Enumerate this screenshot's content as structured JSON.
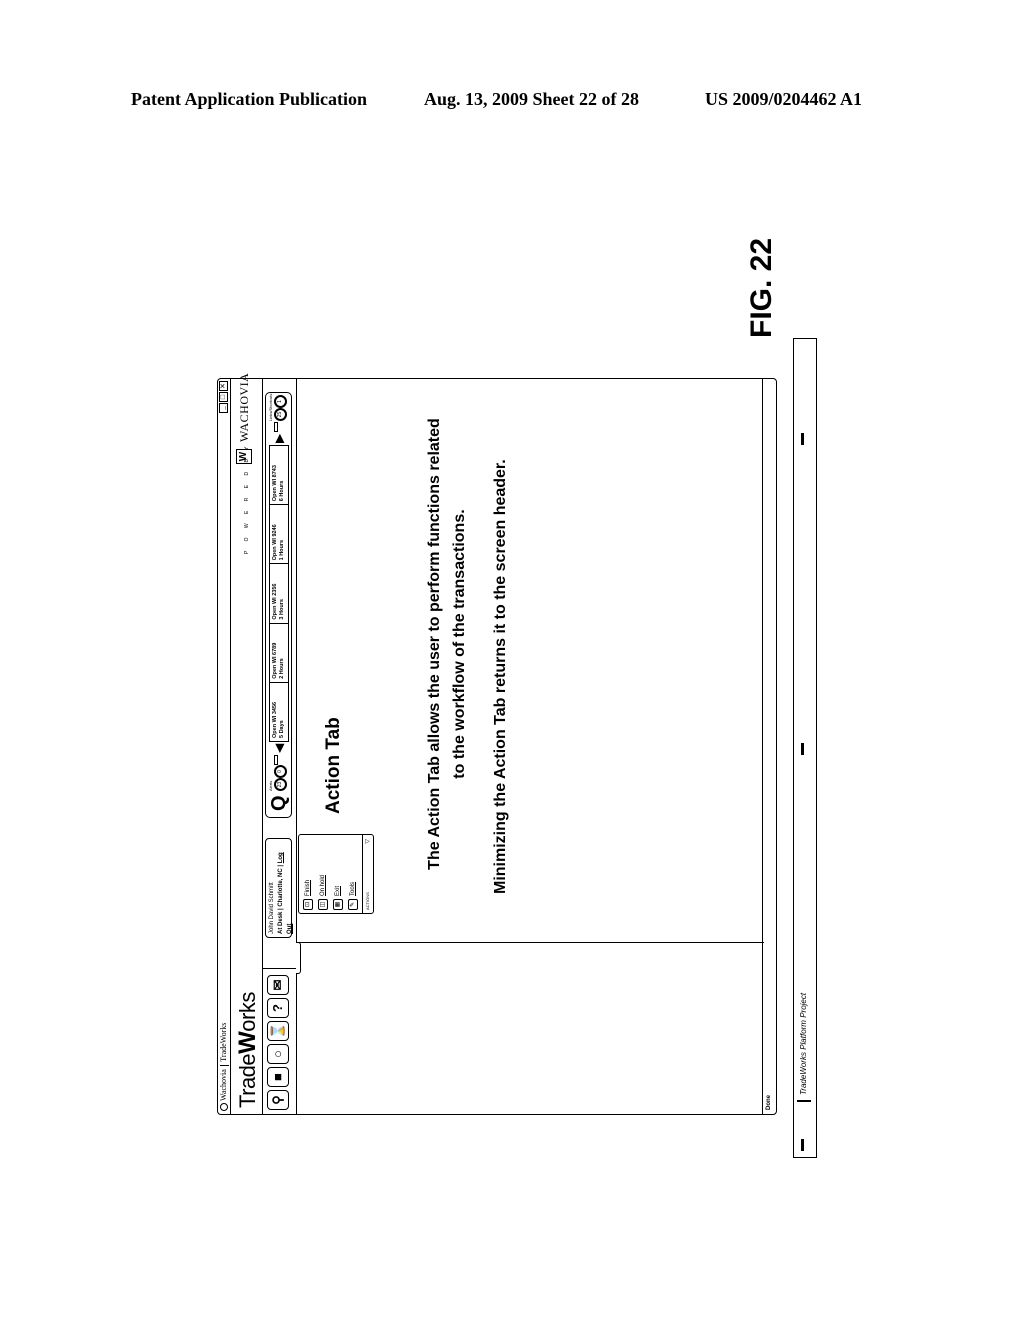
{
  "page_header": {
    "left": "Patent Application Publication",
    "middle": "Aug. 13, 2009  Sheet 22 of 28",
    "right": "US 2009/0204462 A1"
  },
  "window": {
    "titlebar": {
      "tab1": "Wachovia",
      "tab2": "TradeWorks",
      "controls": [
        "_",
        "□",
        "✕"
      ]
    },
    "brand": {
      "part1": "Trade",
      "part2": "W",
      "part3": "orks"
    },
    "powered_by": "P O W E R E D  B Y",
    "partner_logo_glyph": "W",
    "partner_name": "WACHOVIA",
    "toolbar": {
      "buttons": [
        {
          "name": "search",
          "glyph": "⚲"
        },
        {
          "name": "stop",
          "glyph": "■"
        },
        {
          "name": "circle",
          "glyph": "○"
        },
        {
          "name": "hourglass",
          "glyph": "⌛"
        },
        {
          "name": "help",
          "glyph": "?"
        },
        {
          "name": "mail",
          "glyph": "✉"
        }
      ],
      "user": {
        "name": "John David Schmitt",
        "status": "At Desk",
        "location": "Charlotte, NC",
        "logout": "Log Out"
      },
      "quick_search_glyph": "Q",
      "alerts": {
        "label": "Alerts",
        "values": [
          "23",
          "0"
        ]
      },
      "ticker": [
        {
          "title": "Open WI 3456",
          "age": "5 Days"
        },
        {
          "title": "Open WI 6789",
          "age": "2 Hours"
        },
        {
          "title": "Open WI 2356",
          "age": "3 Hours"
        },
        {
          "title": "Open WI 9246",
          "age": "1 Hours"
        },
        {
          "title": "Open WI 8743",
          "age": "6 Hours"
        }
      ],
      "links": {
        "label": "Links/Shortcuts",
        "values": [
          "25",
          "1"
        ]
      }
    },
    "action_panel": {
      "items": [
        {
          "label": "Finish",
          "glyph": "⊡"
        },
        {
          "label": "On hold",
          "glyph": "◫"
        },
        {
          "label": "Exit",
          "glyph": "▦"
        },
        {
          "label": "Tools",
          "glyph": "✎"
        }
      ],
      "footer_label": "ACTIONS",
      "toggle_glyph": "▽"
    },
    "content": {
      "title": "Action Tab",
      "desc1": "The Action Tab allows the user to perform functions related to the workflow of the transactions.",
      "desc2": "Minimizing the Action Tab returns it to the screen header."
    },
    "status": "Done"
  },
  "footer_bar": {
    "text": "TradeWorks Platform Project"
  },
  "figure_label": "FIG. 22"
}
